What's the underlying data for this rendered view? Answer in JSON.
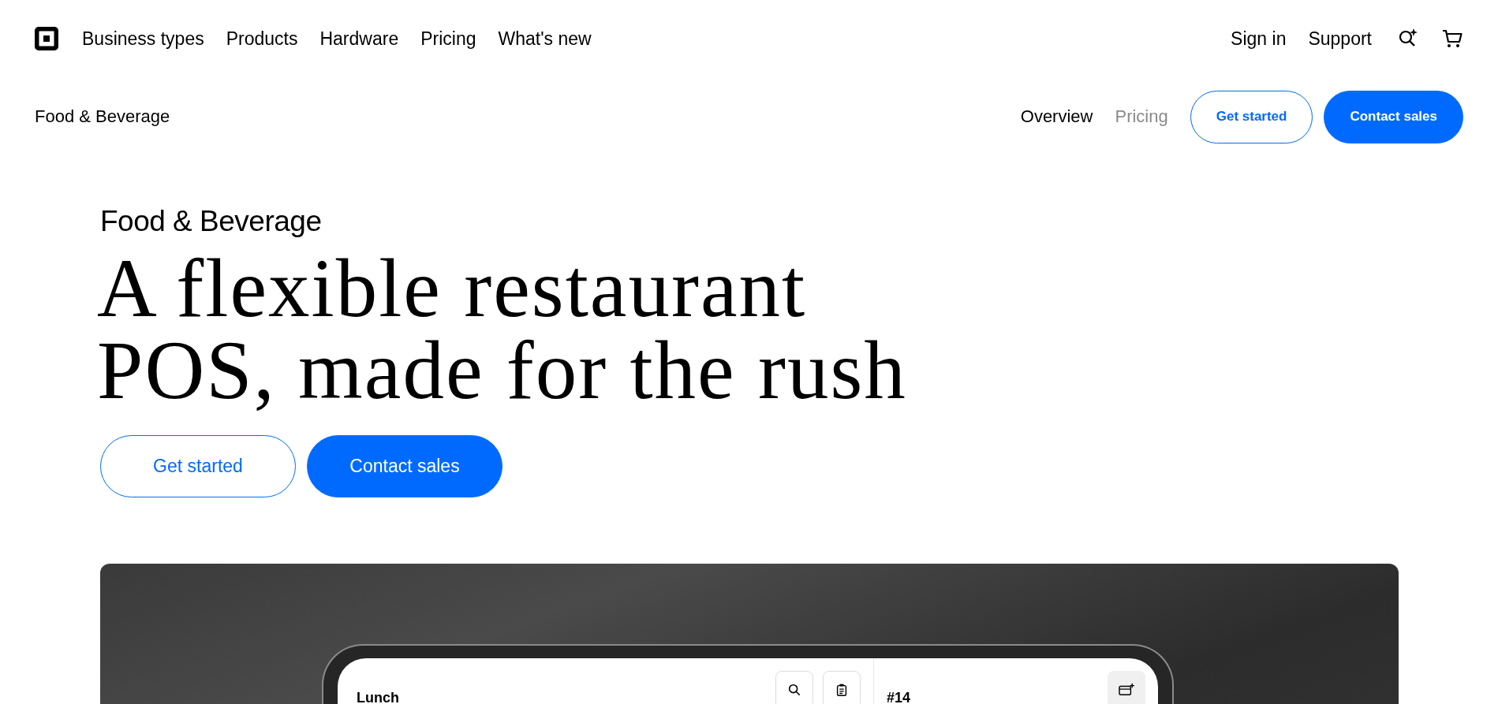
{
  "top_nav": {
    "links": [
      {
        "label": "Business types"
      },
      {
        "label": "Products"
      },
      {
        "label": "Hardware"
      },
      {
        "label": "Pricing"
      },
      {
        "label": "What's new"
      }
    ],
    "right_links": [
      {
        "label": "Sign in"
      },
      {
        "label": "Support"
      }
    ]
  },
  "sub_nav": {
    "title": "Food & Beverage",
    "tabs": [
      {
        "label": "Overview",
        "selected": true
      },
      {
        "label": "Pricing",
        "selected": false
      }
    ],
    "buttons": [
      {
        "label": "Get started",
        "kind": "outline"
      },
      {
        "label": "Contact sales",
        "kind": "filled"
      }
    ]
  },
  "hero": {
    "eyebrow": "Food & Beverage",
    "heading_lines": [
      "A flexible restaurant",
      "POS, made for the rush"
    ],
    "buttons": [
      {
        "label": "Get started",
        "kind": "outline"
      },
      {
        "label": "Contact sales",
        "kind": "filled"
      }
    ]
  },
  "device": {
    "menu_title": "Lunch",
    "order_number": "#14"
  }
}
